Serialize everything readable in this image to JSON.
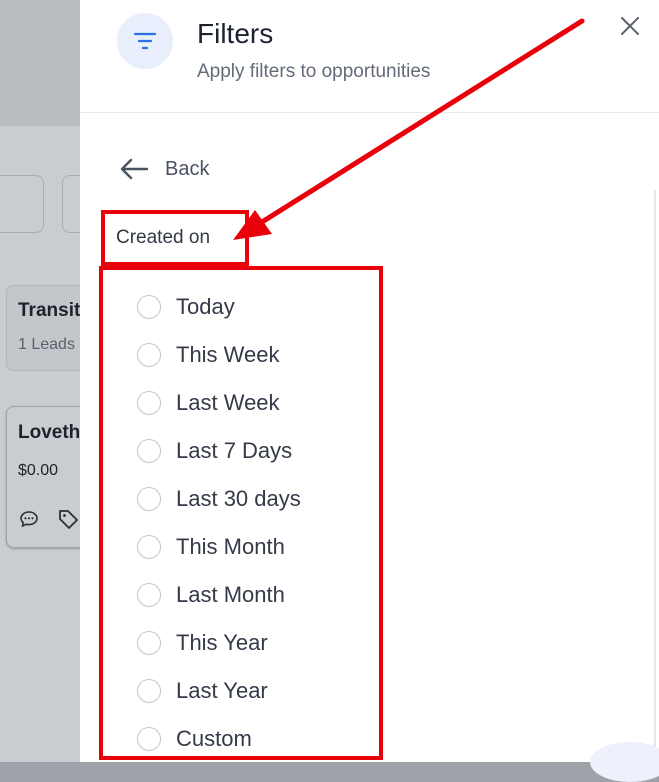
{
  "background": {
    "stage_title": "Transit",
    "stage_leads": "1 Leads",
    "opportunity_name": "Loveth",
    "opportunity_value": "$0.00"
  },
  "panel": {
    "title": "Filters",
    "subtitle": "Apply filters to opportunities",
    "back_label": "Back",
    "section_label": "Created on",
    "options": [
      {
        "label": "Today",
        "selected": false
      },
      {
        "label": "This Week",
        "selected": false
      },
      {
        "label": "Last Week",
        "selected": false
      },
      {
        "label": "Last 7 Days",
        "selected": false
      },
      {
        "label": "Last 30 days",
        "selected": false
      },
      {
        "label": "This Month",
        "selected": false
      },
      {
        "label": "Last Month",
        "selected": false
      },
      {
        "label": "This Year",
        "selected": false
      },
      {
        "label": "Last Year",
        "selected": false
      },
      {
        "label": "Custom",
        "selected": false
      }
    ]
  },
  "icons": {
    "header": "filter-lines-icon",
    "close": "close-icon",
    "back": "arrow-left-icon"
  },
  "colors": {
    "accent": "#2f6fe4",
    "annotation": "#e8000b",
    "overlay": "#9fa3a9"
  }
}
